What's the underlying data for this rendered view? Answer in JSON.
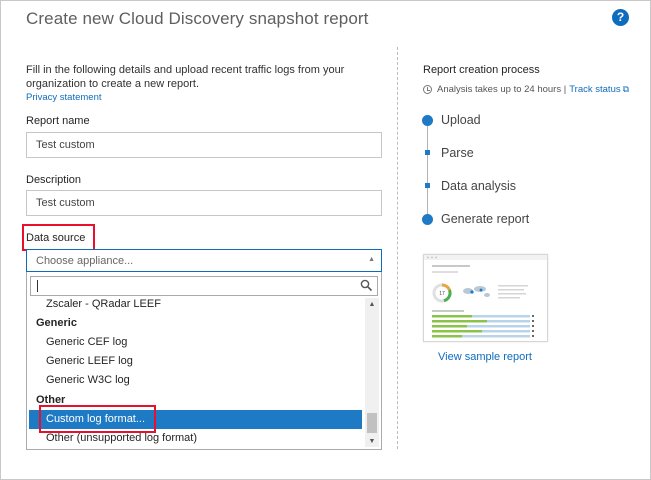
{
  "dialog": {
    "title": "Create new Cloud Discovery snapshot report",
    "help_glyph": "?"
  },
  "intro": {
    "text": "Fill in the following details and upload recent traffic logs from your organization to create a new report.",
    "privacy_link": "Privacy statement"
  },
  "form": {
    "report_name": {
      "label": "Report name",
      "value": "Test custom"
    },
    "description": {
      "label": "Description",
      "value": "Test custom"
    },
    "data_source": {
      "label": "Data source",
      "placeholder": "Choose appliance..."
    }
  },
  "dropdown": {
    "search_value": "",
    "items": [
      {
        "label": "Zscaler - QRadar LEEF",
        "kind": "child"
      },
      {
        "label": "Generic",
        "kind": "group"
      },
      {
        "label": "Generic CEF log",
        "kind": "child"
      },
      {
        "label": "Generic LEEF log",
        "kind": "child"
      },
      {
        "label": "Generic W3C log",
        "kind": "child"
      },
      {
        "label": "Other",
        "kind": "group"
      },
      {
        "label": "Custom log format...",
        "kind": "child",
        "selected": true
      },
      {
        "label": "Other (unsupported log format)",
        "kind": "child"
      }
    ]
  },
  "process": {
    "title": "Report creation process",
    "info": "Analysis takes up to 24 hours |",
    "track_link": "Track status",
    "steps": [
      {
        "label": "Upload",
        "marker": "circle"
      },
      {
        "label": "Parse",
        "marker": "square"
      },
      {
        "label": "Data analysis",
        "marker": "square"
      },
      {
        "label": "Generate report",
        "marker": "circle"
      }
    ],
    "sample_link": "View sample report",
    "thumbnail_figure": "17"
  },
  "colors": {
    "accent": "#1e7ac4",
    "link": "#0f6cbd",
    "highlight": "#e8112d"
  },
  "icons": {
    "help": "help-icon",
    "search": "search-icon",
    "clock": "clock-icon",
    "external": "external-link-icon"
  }
}
